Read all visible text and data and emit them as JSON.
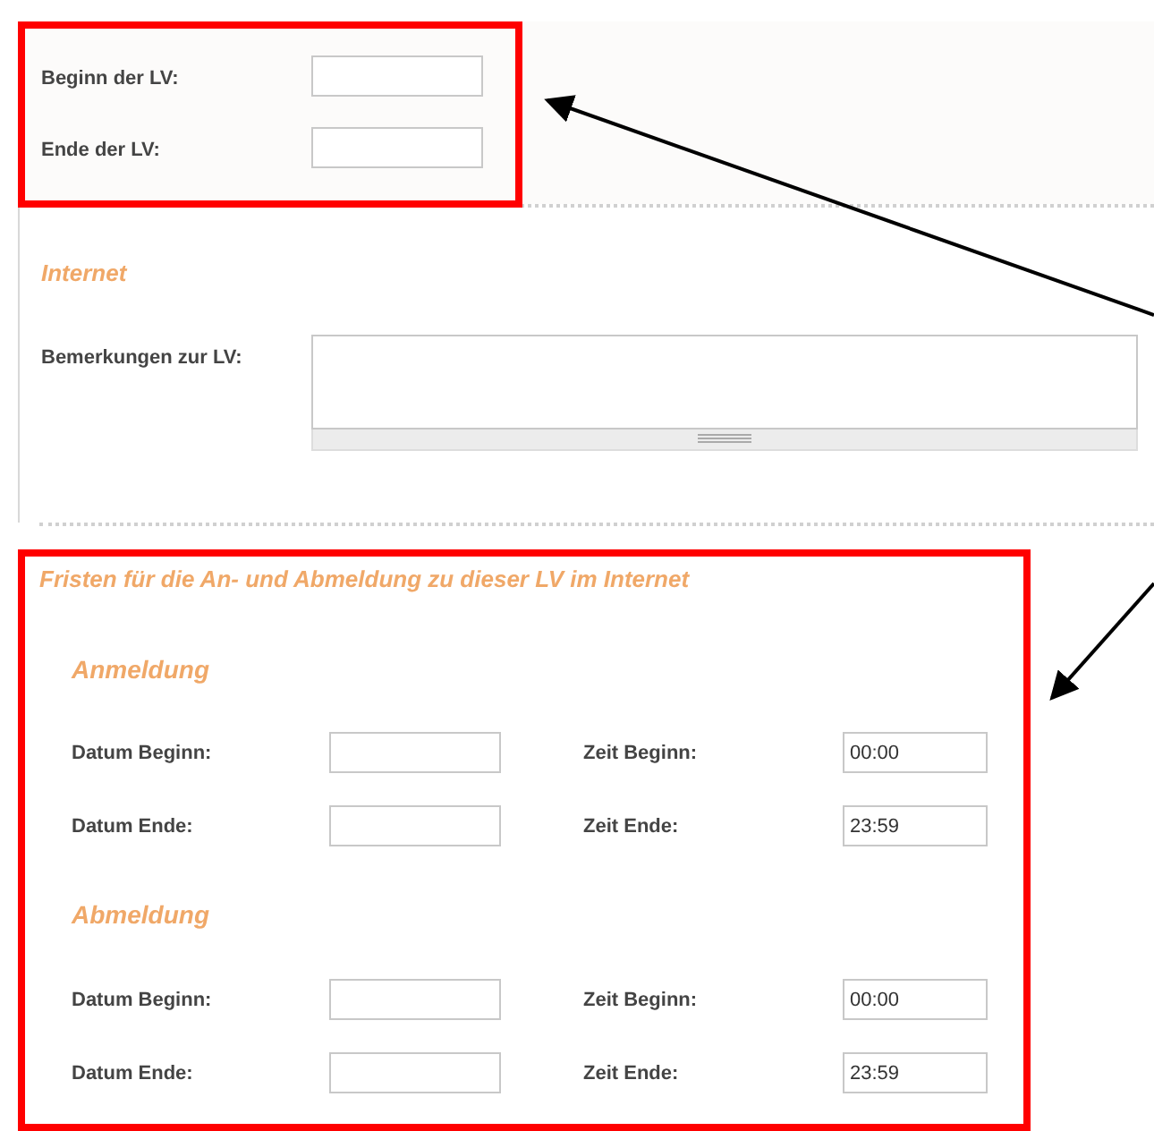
{
  "period_fields": [
    {
      "label": "Beginn der LV:"
    },
    {
      "label": "Ende der LV:"
    }
  ],
  "internet": {
    "heading": "Internet",
    "remarks_label": "Bemerkungen zur LV:"
  },
  "deadlines": {
    "heading": "Fristen für die An- und Abmeldung zu dieser LV im Internet",
    "groups": [
      {
        "heading": "Anmeldung",
        "rows": [
          {
            "date_label": "Datum Beginn:",
            "time_label": "Zeit Beginn:",
            "time_value": "00:00"
          },
          {
            "date_label": "Datum Ende:",
            "time_label": "Zeit Ende:",
            "time_value": "23:59"
          }
        ]
      },
      {
        "heading": "Abmeldung",
        "rows": [
          {
            "date_label": "Datum Beginn:",
            "time_label": "Zeit Beginn:",
            "time_value": "00:00"
          },
          {
            "date_label": "Datum Ende:",
            "time_label": "Zeit Ende:",
            "time_value": "23:59"
          }
        ]
      }
    ]
  }
}
